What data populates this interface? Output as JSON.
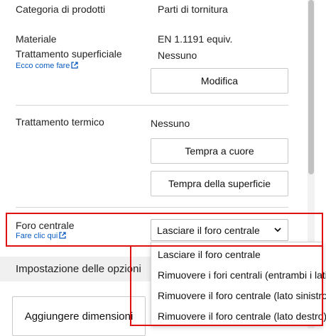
{
  "rows": {
    "categoria": {
      "label": "Categoria di prodotti",
      "value": "Parti di tornitura"
    },
    "materiale": {
      "label": "Materiale",
      "value": "EN 1.1191 equiv."
    },
    "trattamento_superficiale": {
      "label": "Trattamento superficiale",
      "link": "Ecco come fare",
      "value": "Nessuno",
      "button": "Modifica"
    },
    "trattamento_termico": {
      "label": "Trattamento termico",
      "value": "Nessuno",
      "button1": "Tempra a cuore",
      "button2": "Tempra della superficie"
    },
    "foro_centrale": {
      "label": "Foro centrale",
      "link": "Fare clic qui",
      "selected": "Lasciare il foro centrale"
    }
  },
  "dropdown": {
    "options": [
      "Lasciare il foro centrale",
      "Rimuovere i fori centrali (entrambi i lati)",
      "Rimuovere il foro centrale (lato sinistro)",
      "Rimuovere il foro centrale (lato destro)"
    ]
  },
  "section": {
    "title": "Impostazione delle opzioni"
  },
  "actions": {
    "add_dimensions": "Aggiungere dimensioni"
  },
  "icons": {
    "external_link": "external-link-icon",
    "chevron": "chevron-down-icon"
  },
  "colors": {
    "link": "#0a5cc2",
    "highlight": "#e01010"
  }
}
